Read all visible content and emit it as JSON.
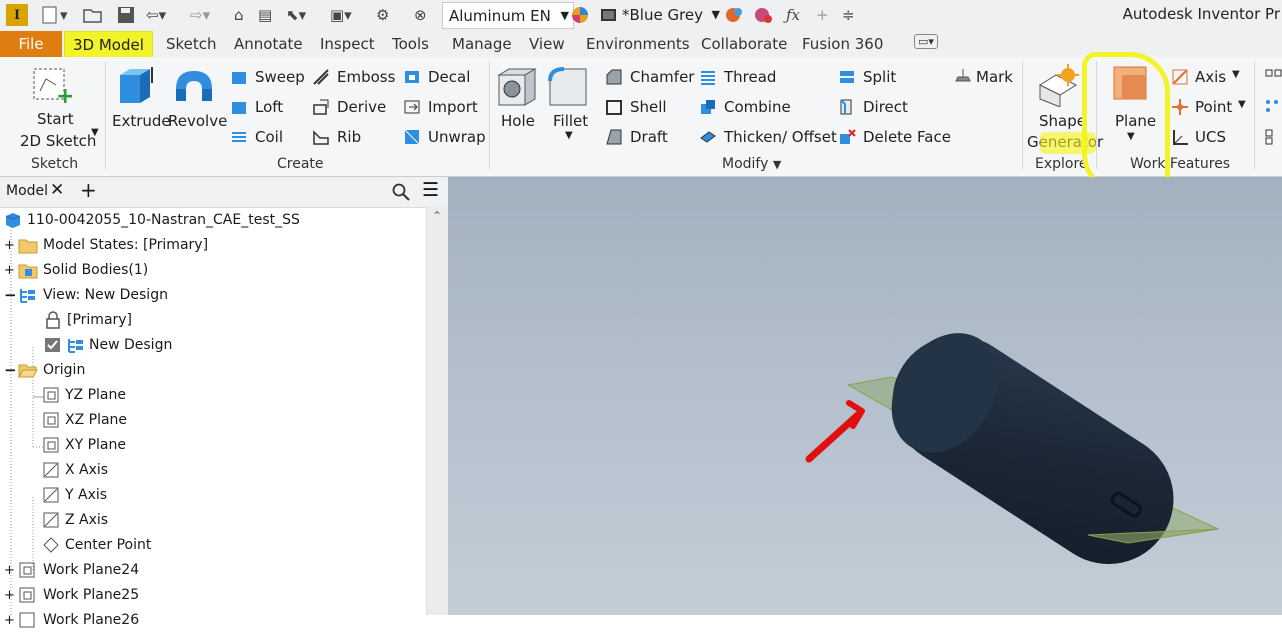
{
  "quick_access": {
    "logo_letter": "I",
    "material": "Aluminum EN",
    "appearance": "*Blue Grey",
    "app_title": "Autodesk Inventor Pr"
  },
  "tabs": {
    "file": "File",
    "items": [
      "3D Model",
      "Sketch",
      "Annotate",
      "Inspect",
      "Tools",
      "Manage",
      "View",
      "Environments",
      "Collaborate",
      "Fusion 360"
    ]
  },
  "ribbon": {
    "sketch": {
      "start1": "Start",
      "start2": "2D Sketch",
      "title": "Sketch"
    },
    "create": {
      "extrude": "Extrude",
      "revolve": "Revolve",
      "sweep": "Sweep",
      "emboss": "Emboss",
      "decal": "Decal",
      "loft": "Loft",
      "derive": "Derive",
      "import": "Import",
      "coil": "Coil",
      "rib": "Rib",
      "unwrap": "Unwrap",
      "title": "Create"
    },
    "modify": {
      "hole": "Hole",
      "fillet": "Fillet",
      "chamfer": "Chamfer",
      "thread": "Thread",
      "split": "Split",
      "shell": "Shell",
      "combine": "Combine",
      "direct": "Direct",
      "draft": "Draft",
      "thicken": "Thicken/ Offset",
      "delete_face": "Delete Face",
      "title": "Modify"
    },
    "mark": "Mark",
    "explore": {
      "shape1": "Shape",
      "shape2": "Generator",
      "title": "Explore"
    },
    "work_features": {
      "plane": "Plane",
      "axis": "Axis",
      "point": "Point",
      "ucs": "UCS",
      "title": "Work Features"
    }
  },
  "browser": {
    "tab": "Model",
    "tree": [
      {
        "label": "110-0042055_10-Nastran_CAE_test_SS"
      },
      {
        "label": "Model States: [Primary]"
      },
      {
        "label": "Solid Bodies(1)"
      },
      {
        "label": "View: New Design"
      },
      {
        "label": "[Primary]"
      },
      {
        "label": "New Design"
      },
      {
        "label": "Origin"
      },
      {
        "label": "YZ Plane"
      },
      {
        "label": "XZ Plane"
      },
      {
        "label": "XY Plane"
      },
      {
        "label": "X Axis"
      },
      {
        "label": "Y Axis"
      },
      {
        "label": "Z Axis"
      },
      {
        "label": "Center Point"
      },
      {
        "label": "Work Plane24"
      },
      {
        "label": "Work Plane25"
      },
      {
        "label": "Work Plane26"
      }
    ]
  },
  "colors": {
    "accent_file": "#e07d10",
    "highlight": "#f3f32a",
    "annotation_arrow": "#e01010",
    "part": "#1d2a3a"
  }
}
